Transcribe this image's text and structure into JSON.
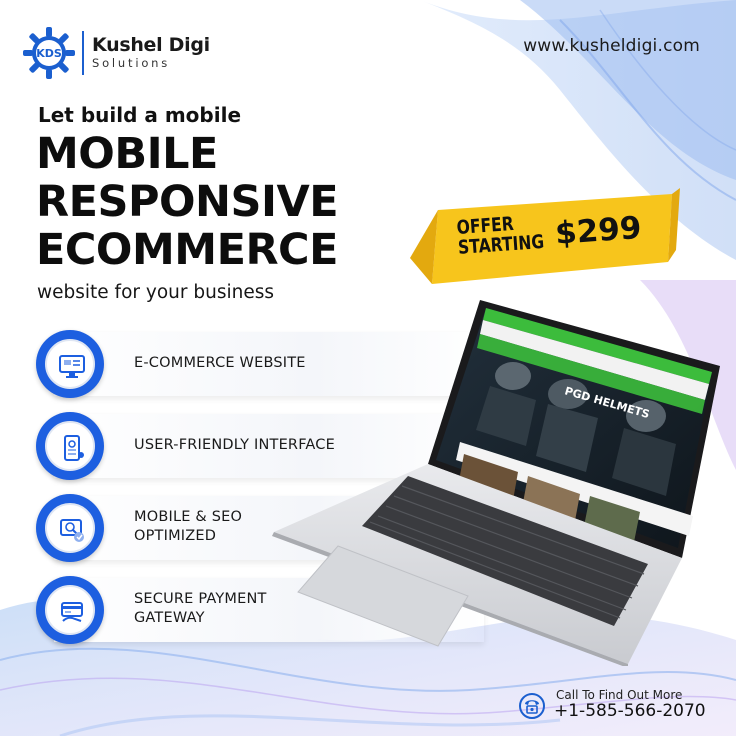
{
  "brand": {
    "name": "Kushel Digi",
    "subtitle": "Solutions",
    "mark_text": "KDS",
    "website": "www.kusheldigi.com"
  },
  "headline": {
    "lead": "Let build a mobile",
    "lines": [
      "MOBILE",
      "RESPONSIVE",
      "ECOMMERCE"
    ],
    "sub": "website for your business"
  },
  "offer": {
    "line1": "OFFER",
    "line2": "STARTING",
    "price": "$299"
  },
  "features": [
    {
      "label": "E-COMMERCE WEBSITE",
      "icon": "website-icon"
    },
    {
      "label": "USER-FRIENDLY INTERFACE",
      "icon": "mobile-app-icon"
    },
    {
      "label": "MOBILE & SEO OPTIMIZED",
      "label_lines": [
        "MOBILE & SEO",
        "OPTIMIZED"
      ],
      "icon": "seo-icon"
    },
    {
      "label": "SECURE PAYMENT GATEWAY",
      "label_lines": [
        "SECURE PAYMENT",
        "GATEWAY"
      ],
      "icon": "payment-icon"
    }
  ],
  "laptop_screen": {
    "hero_text": "PGD HELMETS"
  },
  "contact": {
    "label": "Call To Find Out More",
    "phone": "+1-585-566-2070"
  },
  "colors": {
    "brand_blue": "#1d5fe0",
    "offer_yellow": "#f7c51c",
    "screen_green": "#3cbc3c"
  }
}
